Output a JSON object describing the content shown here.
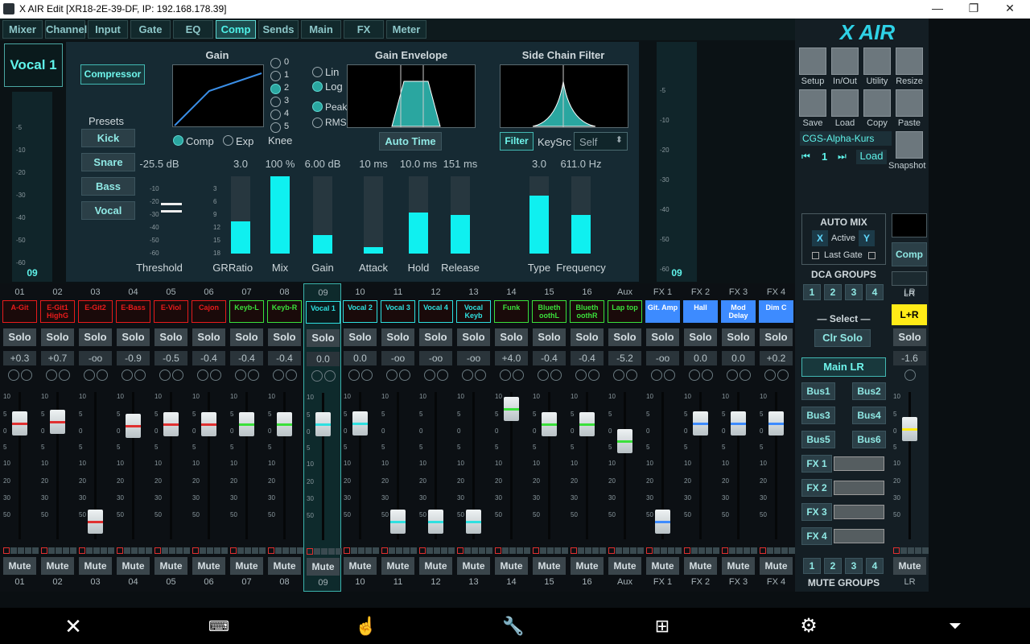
{
  "window": {
    "title": "X AIR Edit [XR18-2E-39-DF, IP: 192.168.178.39]"
  },
  "tabs": [
    "Mixer",
    "Channel",
    "Input",
    "Gate",
    "EQ",
    "Comp",
    "Sends",
    "Main",
    "FX",
    "Meter"
  ],
  "comp": {
    "channel_name": "Vocal 1",
    "channel_num": "09",
    "right_num": "09",
    "compressor_btn": "Compressor",
    "presets_label": "Presets",
    "presets": [
      "Kick",
      "Snare",
      "Bass",
      "Vocal"
    ],
    "gain_title": "Gain",
    "knee_options": [
      "0",
      "1",
      "2",
      "3",
      "4",
      "5"
    ],
    "knee_label": "Knee",
    "mode_comp": "Comp",
    "mode_exp": "Exp",
    "env_title": "Gain Envelope",
    "lin": "Lin",
    "log": "Log",
    "peak": "Peak",
    "rms": "RMS",
    "auto_time": "Auto Time",
    "sc_title": "Side Chain Filter",
    "filter_btn": "Filter",
    "keysrc_label": "KeySrc",
    "keysrc_value": "Self",
    "params": [
      {
        "label": "Threshold",
        "value": "-25.5 dB"
      },
      {
        "label": "GR",
        "value": ""
      },
      {
        "label": "Ratio",
        "value": "3.0",
        "level": 0.42
      },
      {
        "label": "Mix",
        "value": "100 %",
        "level": 1.0
      },
      {
        "label": "Gain",
        "value": "6.00 dB",
        "level": 0.24
      },
      {
        "label": "Attack",
        "value": "10 ms",
        "level": 0.08
      },
      {
        "label": "Hold",
        "value": "10.0 ms",
        "level": 0.53
      },
      {
        "label": "Release",
        "value": "151 ms",
        "level": 0.5
      },
      {
        "label": "Type",
        "value": "3.0",
        "level": 0.75
      },
      {
        "label": "Frequency",
        "value": "611.0 Hz",
        "level": 0.5
      }
    ],
    "thr_scale": [
      "-10",
      "-20",
      "-30",
      "-40",
      "-50",
      "-60"
    ],
    "gr_scale": [
      "3",
      "6",
      "9",
      "12",
      "15",
      "18"
    ],
    "meter_scale": [
      "-5",
      "-10",
      "-20",
      "-30",
      "-40",
      "-50",
      "-60"
    ]
  },
  "right": {
    "brand": "X AIR",
    "icons": [
      {
        "label": "Setup",
        "icon": "gear-icon"
      },
      {
        "label": "In/Out",
        "icon": "arrows-icon"
      },
      {
        "label": "Utility",
        "icon": "wrench-icon"
      },
      {
        "label": "Resize",
        "icon": "resize-icon"
      },
      {
        "label": "Save",
        "icon": "save-icon"
      },
      {
        "label": "Load",
        "icon": "folder-icon"
      },
      {
        "label": "Copy",
        "icon": "copy-icon"
      },
      {
        "label": "Paste",
        "icon": "paste-icon"
      }
    ],
    "snapshot_name": "CGS-Alpha-Kurs",
    "snapshot_num": "1",
    "load": "Load",
    "snapshot": "Snapshot",
    "automix": "AUTO MIX",
    "x": "X",
    "active": "Active",
    "y": "Y",
    "last_gate": "Last Gate",
    "comp": "Comp",
    "lr": "LR",
    "dca_groups": "DCA GROUPS",
    "groups": [
      "1",
      "2",
      "3",
      "4"
    ],
    "select": "Select",
    "clr_solo": "Clr Solo",
    "main_lr": "Main LR",
    "buses": [
      "Bus1",
      "Bus2",
      "Bus3",
      "Bus4",
      "Bus5",
      "Bus6"
    ],
    "fx": [
      "FX 1",
      "FX 2",
      "FX 3",
      "FX 4"
    ],
    "mute_groups": "MUTE GROUPS"
  },
  "strips": [
    {
      "num": "01",
      "name": "A-Git",
      "color": "#e81b1b",
      "gain": "+0.3",
      "level": 0.22,
      "line": "#e03030"
    },
    {
      "num": "02",
      "name": "E-Git1 HighG",
      "color": "#e81b1b",
      "gain": "+0.7",
      "level": 0.21,
      "line": "#e03030"
    },
    {
      "num": "03",
      "name": "E-Git2",
      "color": "#e81b1b",
      "gain": "-oo",
      "level": 0.92,
      "line": "#e03030"
    },
    {
      "num": "04",
      "name": "E-Bass",
      "color": "#e81b1b",
      "gain": "-0.9",
      "level": 0.24,
      "line": "#e03030"
    },
    {
      "num": "05",
      "name": "E-Viol",
      "color": "#e81b1b",
      "gain": "-0.5",
      "level": 0.23,
      "line": "#e03030"
    },
    {
      "num": "06",
      "name": "Cajon",
      "color": "#e81b1b",
      "gain": "-0.4",
      "level": 0.23,
      "line": "#e03030"
    },
    {
      "num": "07",
      "name": "Keyb-L",
      "color": "#3be03b",
      "gain": "-0.4",
      "level": 0.23,
      "line": "#3be03b"
    },
    {
      "num": "08",
      "name": "Keyb-R",
      "color": "#3be03b",
      "gain": "-0.4",
      "level": 0.23,
      "line": "#3be03b"
    },
    {
      "num": "09",
      "name": "Vocal 1",
      "color": "#2fe0e0",
      "gain": "0.0",
      "level": 0.22,
      "line": "#2fe0e0"
    },
    {
      "num": "10",
      "name": "Vocal 2",
      "color": "#2fe0e0",
      "gain": "0.0",
      "level": 0.22,
      "line": "#2fe0e0"
    },
    {
      "num": "11",
      "name": "Vocal 3",
      "color": "#2fe0e0",
      "gain": "-oo",
      "level": 0.92,
      "line": "#2fe0e0"
    },
    {
      "num": "12",
      "name": "Vocal 4",
      "color": "#2fe0e0",
      "gain": "-oo",
      "level": 0.92,
      "line": "#2fe0e0"
    },
    {
      "num": "13",
      "name": "Vocal Keyb",
      "color": "#2fe0e0",
      "gain": "-oo",
      "level": 0.92,
      "line": "#2fe0e0"
    },
    {
      "num": "14",
      "name": "Funk",
      "color": "#3be03b",
      "gain": "+4.0",
      "level": 0.12,
      "line": "#3be03b"
    },
    {
      "num": "15",
      "name": "Blueth oothL",
      "color": "#3be03b",
      "gain": "-0.4",
      "level": 0.23,
      "line": "#3be03b"
    },
    {
      "num": "16",
      "name": "Blueth oothR",
      "color": "#3be03b",
      "gain": "-0.4",
      "level": 0.23,
      "line": "#3be03b"
    },
    {
      "num": "Aux",
      "name": "Lap top",
      "color": "#3be03b",
      "gain": "-5.2",
      "level": 0.35,
      "line": "#3be03b"
    },
    {
      "num": "FX 1",
      "name": "Git. Amp",
      "color": "#3d8bff",
      "gain": "-oo",
      "level": 0.92,
      "line": "#3d8bff"
    },
    {
      "num": "FX 2",
      "name": "Hall",
      "color": "#3d8bff",
      "gain": "0.0",
      "level": 0.22,
      "line": "#3d8bff"
    },
    {
      "num": "FX 3",
      "name": "Mod Delay",
      "color": "#3d8bff",
      "gain": "0.0",
      "level": 0.22,
      "line": "#3d8bff"
    },
    {
      "num": "FX 4",
      "name": "Dim C",
      "color": "#3d8bff",
      "gain": "+0.2",
      "level": 0.22,
      "line": "#3d8bff"
    }
  ],
  "lr_strip": {
    "num": "LR",
    "name": "L+R",
    "gain": "-1.6",
    "level": 0.26
  },
  "fader_scale": [
    "10",
    "5",
    "0",
    "5",
    "10",
    "20",
    "30",
    "50"
  ],
  "solo": "Solo",
  "mute": "Mute"
}
